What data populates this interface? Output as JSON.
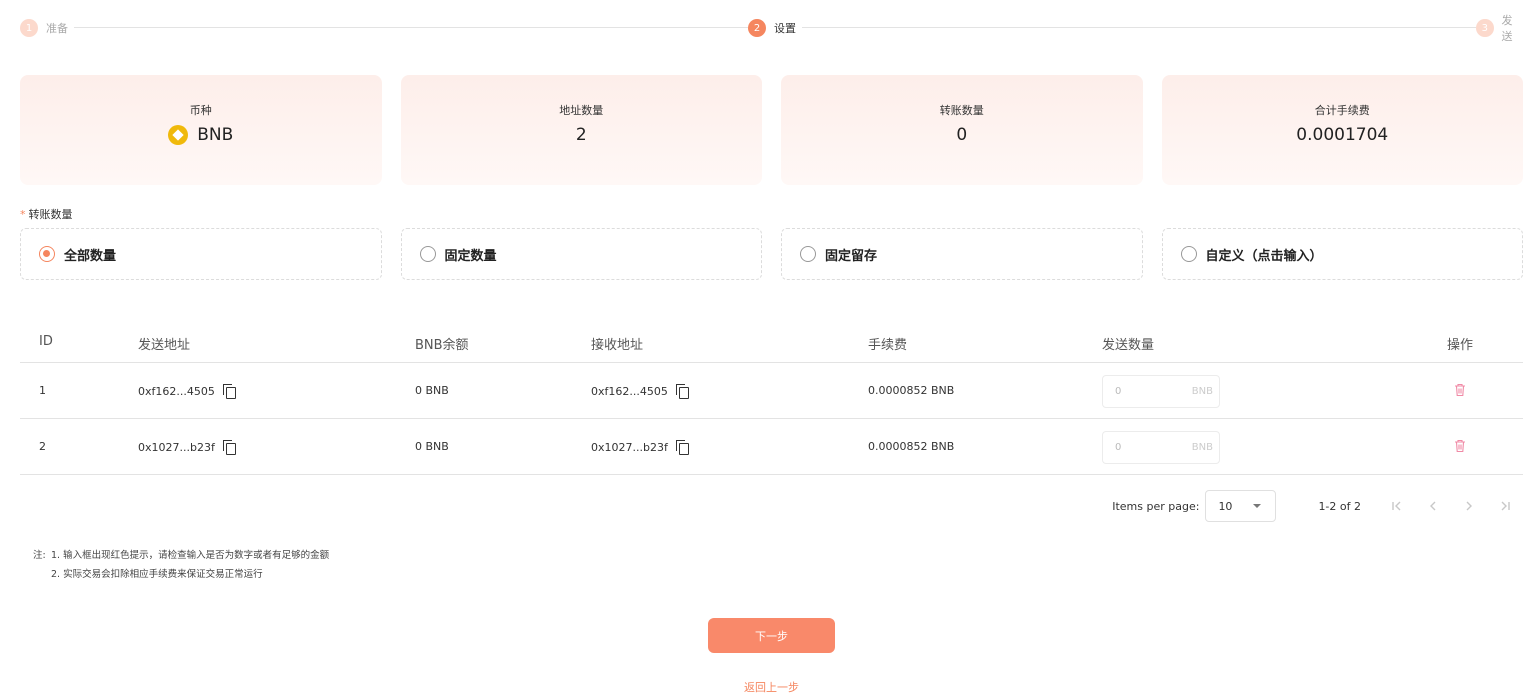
{
  "stepper": {
    "steps": [
      {
        "num": "1",
        "label": "准备"
      },
      {
        "num": "2",
        "label": "设置"
      },
      {
        "num": "3",
        "label": "发送"
      }
    ]
  },
  "summary": {
    "currency_title": "币种",
    "currency_value": "BNB",
    "address_count_title": "地址数量",
    "address_count_value": "2",
    "transfer_amount_title": "转账数量",
    "transfer_amount_value": "0",
    "total_fee_title": "合计手续费",
    "total_fee_value": "0.0001704"
  },
  "amount_type": {
    "required_mark": "*",
    "label": "转账数量",
    "options": [
      {
        "label": "全部数量",
        "selected": true
      },
      {
        "label": "固定数量",
        "selected": false
      },
      {
        "label": "固定留存",
        "selected": false
      },
      {
        "label": "自定义（点击输入）",
        "selected": false
      }
    ]
  },
  "table": {
    "headers": {
      "id": "ID",
      "from": "发送地址",
      "balance": "BNB余额",
      "to": "接收地址",
      "fee": "手续费",
      "amount": "发送数量",
      "action": "操作"
    },
    "rows": [
      {
        "id": "1",
        "from": "0xf162...4505",
        "balance": "0 BNB",
        "to": "0xf162...4505",
        "fee": "0.0000852 BNB",
        "amount": "0",
        "unit": "BNB"
      },
      {
        "id": "2",
        "from": "0x1027...b23f",
        "balance": "0 BNB",
        "to": "0x1027...b23f",
        "fee": "0.0000852 BNB",
        "amount": "0",
        "unit": "BNB"
      }
    ]
  },
  "pagination": {
    "items_per_page_label": "Items per page:",
    "items_per_page": "10",
    "range": "1-2 of 2"
  },
  "notes": {
    "prefix": "注:",
    "line1": "1. 输入框出现红色提示，请检查输入是否为数字或者有足够的金额",
    "line2": "2. 实际交易会扣除相应手续费来保证交易正常运行"
  },
  "actions": {
    "next": "下一步",
    "back": "返回上一步"
  },
  "colors": {
    "accent": "#f5865f",
    "button": "#f9896a",
    "bnb": "#f0b90b"
  }
}
